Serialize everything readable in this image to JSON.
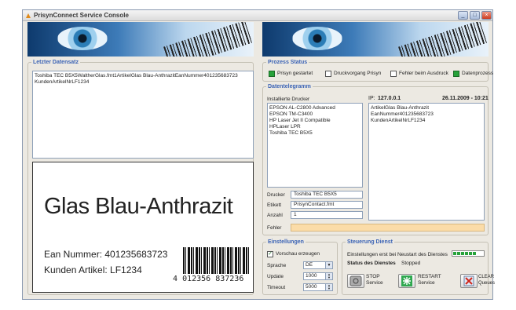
{
  "window": {
    "title": "PrisynConnect Service Console"
  },
  "last_record": {
    "legend": "Letzter Datensatz",
    "text": "Toshiba TEC B5X5WaltherGlas.fmt1ArtikelGlas Blau-AnthrazitEanNummer401235683723\nKundenArtikelNrLF1234"
  },
  "label_preview": {
    "product": "Glas Blau-Anthrazit",
    "ean_line": "Ean Nummer: 401235683723",
    "customer_line": "Kunden Artikel: LF1234",
    "barcode_lead": "4",
    "barcode_mid": "012356",
    "barcode_end": "837236"
  },
  "process_status": {
    "legend": "Prozess Status",
    "items": [
      {
        "label": "Prisyn gestartet",
        "checked": true
      },
      {
        "label": "Druckvorgang Prisyn",
        "checked": false
      },
      {
        "label": "Fehler beim Ausdruck",
        "checked": false
      },
      {
        "label": "Datenprozess",
        "checked": true
      }
    ]
  },
  "data_telegram": {
    "legend": "Datentelegramm",
    "printers_label": "Installierte Drucker",
    "printers": "EPSON AL-C2800 Advanced\nEPSON TM-C3400\nHP Laser Jet II Compatible\nHPLaser LPR\nToshiba TEC B5X5",
    "ip_label": "IP:",
    "ip": "127.0.0.1",
    "datetime": "26.11.2009 - 10:21",
    "telegram": "ArtikelGlas Blau-Anthrazit\nEanNummer401235683723\nKundenArtikelNrLF1234",
    "printer_label": "Drucker",
    "printer": "Toshiba TEC B5X5",
    "etikett_label": "Etikett",
    "etikett": "PrisynContact.fmt",
    "anzahl_label": "Anzahl",
    "anzahl": "1",
    "fehler_label": "Fehler",
    "fehler": ""
  },
  "settings": {
    "legend": "Einstellungen",
    "preview_label": "Vorschau erzeugen",
    "preview_checked": true,
    "language_label": "Sprache",
    "language": "DE",
    "update_label": "Update",
    "update": "1000",
    "timeout_label": "Timeout",
    "timeout": "5000"
  },
  "service_control": {
    "legend": "Steuerung Dienst",
    "restart_note": "Einstellungen erst bei Neustart des Dienstes",
    "status_label": "Status des Dienstes",
    "status_value": "Stopped",
    "progress": 0.8,
    "stop_label": "STOP\nService",
    "restart_label": "RESTART\nService",
    "clear_label": "CLEAR\nQueues"
  },
  "colors": {
    "accent": "#3b63b5",
    "status_on": "#27a23a",
    "error_field": "#fbdca8"
  }
}
